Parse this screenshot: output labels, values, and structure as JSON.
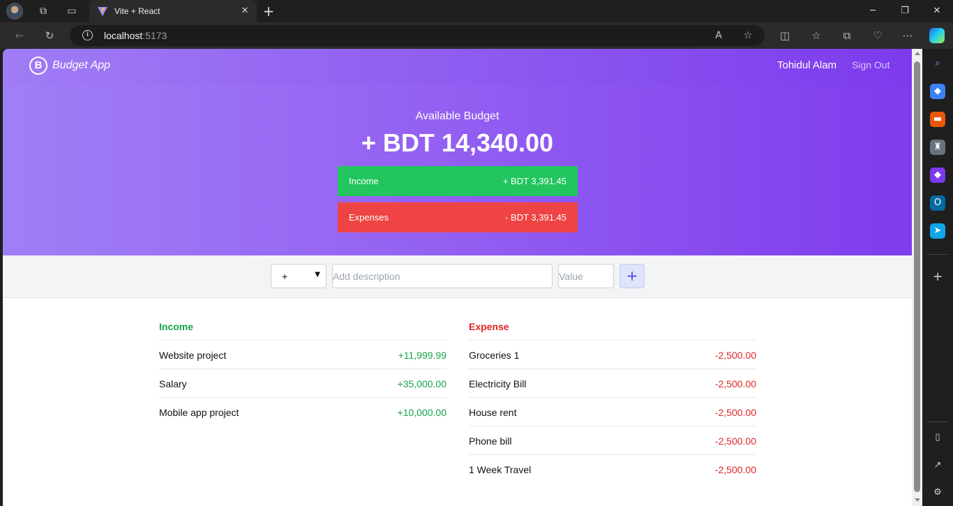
{
  "browser": {
    "tab_title": "Vite + React",
    "url_host": "localhost",
    "url_port": ":5173"
  },
  "app": {
    "brand": "Budget App",
    "user_name": "Tohidul Alam",
    "sign_out": "Sign Out"
  },
  "hero": {
    "label": "Available Budget",
    "amount": "+ BDT 14,340.00",
    "income_label": "Income",
    "income_value": "+ BDT 3,391.45",
    "expenses_label": "Expenses",
    "expenses_value": "- BDT 3,391.45"
  },
  "form": {
    "type_selected": "+",
    "description_placeholder": "Add description",
    "value_placeholder": "Value",
    "add_symbol": "+"
  },
  "income": {
    "title": "Income",
    "items": [
      {
        "description": "Website project",
        "amount": "+11,999.99"
      },
      {
        "description": "Salary",
        "amount": "+35,000.00"
      },
      {
        "description": "Mobile app project",
        "amount": "+10,000.00"
      }
    ]
  },
  "expense": {
    "title": "Expense",
    "items": [
      {
        "description": "Groceries 1",
        "amount": "-2,500.00"
      },
      {
        "description": "Electricity Bill",
        "amount": "-2,500.00"
      },
      {
        "description": "House rent",
        "amount": "-2,500.00"
      },
      {
        "description": "Phone bill",
        "amount": "-2,500.00"
      },
      {
        "description": "1 Week Travel",
        "amount": "-2,500.00"
      }
    ]
  },
  "colors": {
    "income_green": "#16a34a",
    "expense_red": "#dc2626",
    "purple": "#8b5cf6"
  }
}
